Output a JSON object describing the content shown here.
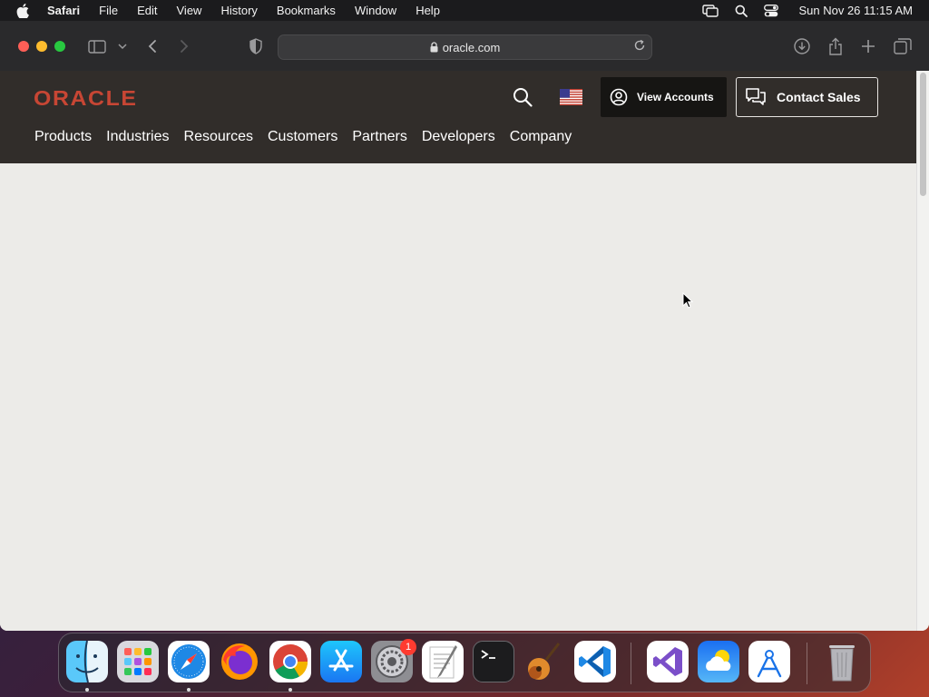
{
  "menubar": {
    "app_name": "Safari",
    "items": [
      "File",
      "Edit",
      "View",
      "History",
      "Bookmarks",
      "Window",
      "Help"
    ],
    "clock": "Sun Nov 26  11:15 AM",
    "icons": [
      "screen-mirroring-icon",
      "spotlight-icon",
      "control-center-icon"
    ]
  },
  "browser": {
    "url": "oracle.com"
  },
  "oracle": {
    "logo_text": "ORACLE",
    "brand_color": "#c74634",
    "header_color": "#312d2a",
    "view_accounts_label": "View Accounts",
    "contact_sales_label": "Contact Sales",
    "nav": [
      "Products",
      "Industries",
      "Resources",
      "Customers",
      "Partners",
      "Developers",
      "Company"
    ]
  },
  "dock": {
    "apps": [
      "finder",
      "launchpad",
      "safari",
      "firefox",
      "chrome",
      "app-store",
      "system-preferences",
      "textedit",
      "terminal",
      "garageband",
      "vscode",
      "visual-studio",
      "weather",
      "instruments",
      "trash"
    ],
    "system_preferences_badge": "1"
  }
}
